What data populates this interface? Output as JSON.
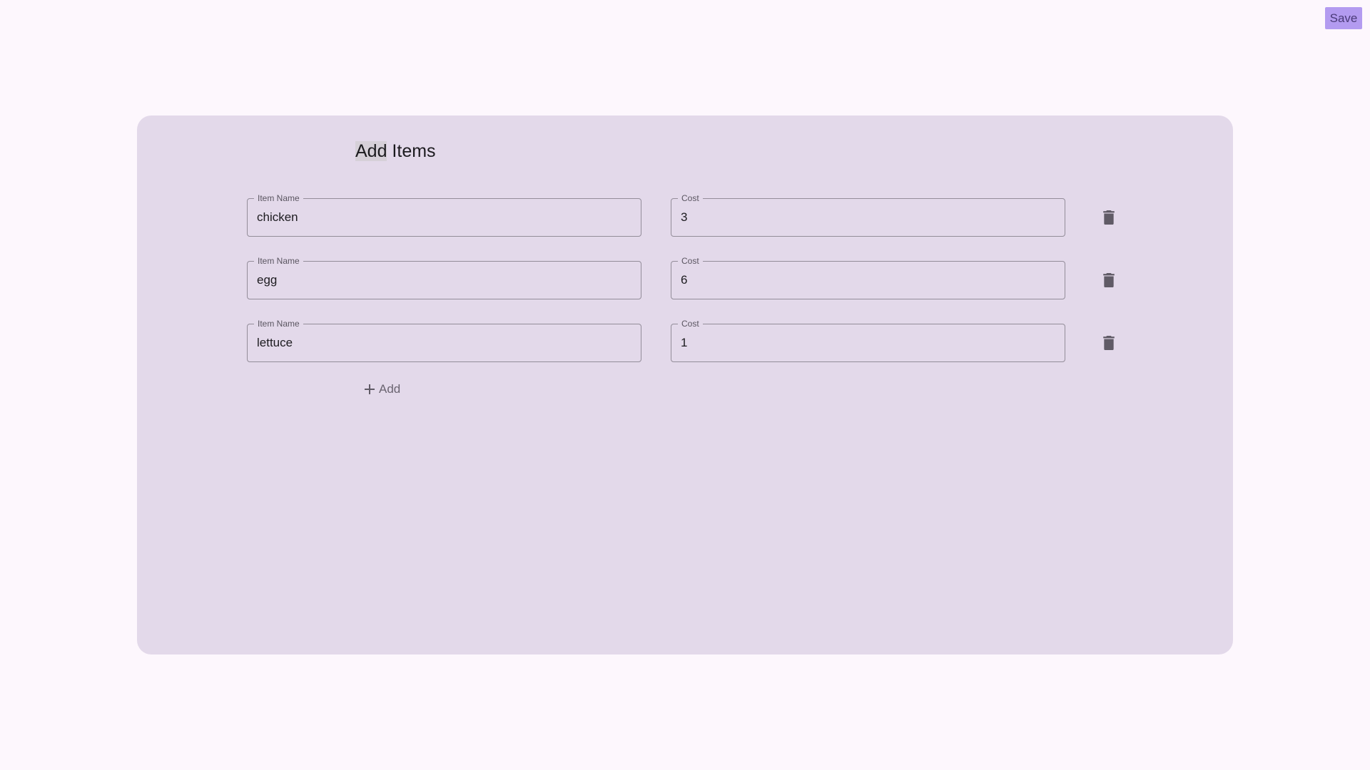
{
  "header": {
    "save_label": "Save"
  },
  "form": {
    "title_highlighted": "Add",
    "title_rest": " Items",
    "items": [
      {
        "name_label": "Item Name",
        "name_value": "chicken",
        "cost_label": "Cost",
        "cost_value": "3",
        "delete_icon": "trash-icon"
      },
      {
        "name_label": "Item Name",
        "name_value": "egg",
        "cost_label": "Cost",
        "cost_value": "6",
        "delete_icon": "trash-icon"
      },
      {
        "name_label": "Item Name",
        "name_value": "lettuce",
        "cost_label": "Cost",
        "cost_value": "1",
        "delete_icon": "trash-icon"
      }
    ],
    "add_label": "Add",
    "add_icon": "plus-icon"
  },
  "colors": {
    "page_background": "#fdf7fd",
    "card_background": "#e3d9ea",
    "save_button": "#b39bf0",
    "field_border": "#938d99",
    "icon": "#605b66"
  }
}
